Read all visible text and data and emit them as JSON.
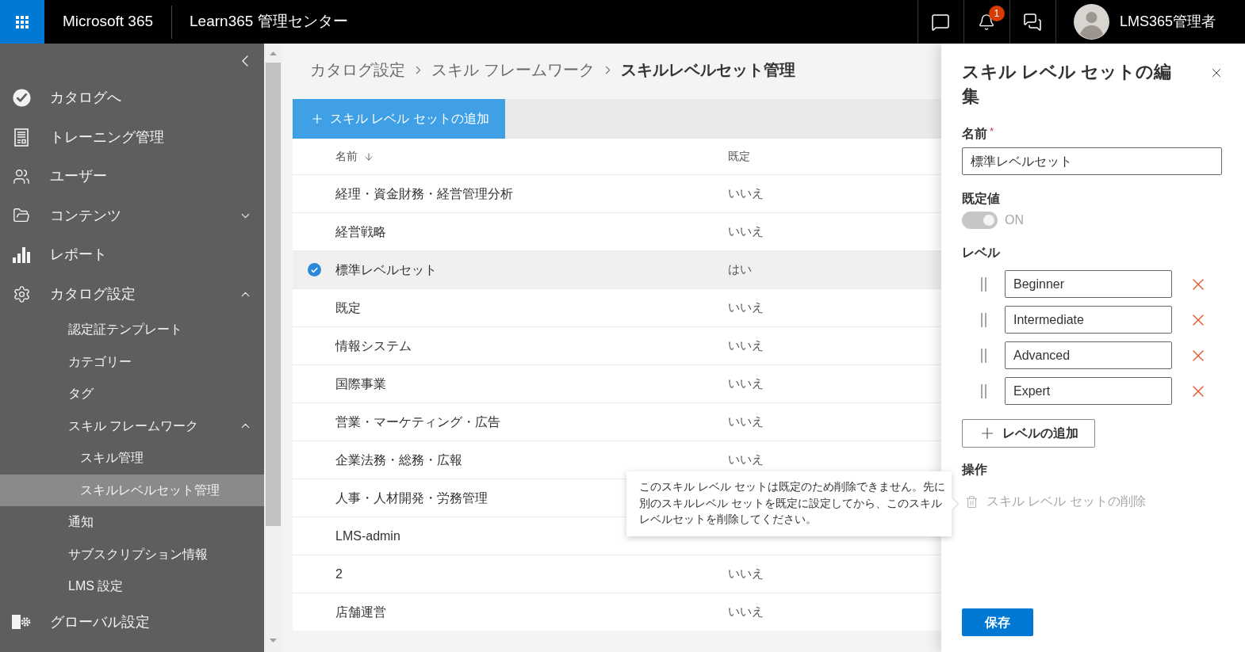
{
  "top_bar": {
    "brand": "Microsoft 365",
    "title": "Learn365 管理センター",
    "notification_badge": "1",
    "user_name": "LMS365管理者"
  },
  "sidebar": {
    "items": [
      {
        "label": "カタログへ",
        "selected": false
      },
      {
        "label": "トレーニング管理",
        "selected": false
      },
      {
        "label": "ユーザー",
        "selected": false
      },
      {
        "label": "コンテンツ",
        "selected": false,
        "expanded": false
      },
      {
        "label": "レポート",
        "selected": false
      },
      {
        "label": "カタログ設定",
        "selected": false,
        "expanded": true,
        "children": [
          {
            "label": "認定証テンプレート",
            "selected": false
          },
          {
            "label": "カテゴリー",
            "selected": false
          },
          {
            "label": "タグ",
            "selected": false
          },
          {
            "label": "スキル フレームワーク",
            "selected": false,
            "expanded": true,
            "children": [
              {
                "label": "スキル管理",
                "selected": false
              },
              {
                "label": "スキルレベルセット管理",
                "selected": true
              }
            ]
          },
          {
            "label": "通知",
            "selected": false
          },
          {
            "label": "サブスクリプション情報",
            "selected": false
          },
          {
            "label": "LMS 設定",
            "selected": false
          }
        ]
      },
      {
        "label": "グローバル設定",
        "selected": false
      }
    ]
  },
  "breadcrumb": [
    "カタログ設定",
    "スキル フレームワーク",
    "スキルレベルセット管理"
  ],
  "toolbar": {
    "add_button": "スキル レベル セットの追加"
  },
  "table": {
    "columns": [
      {
        "label": "名前",
        "sorted": true
      },
      {
        "label": "既定",
        "sorted": false
      }
    ],
    "rows": [
      {
        "name": "経理・資金財務・経営管理分析",
        "default": "いいえ",
        "selected": false
      },
      {
        "name": "経営戦略",
        "default": "いいえ",
        "selected": false
      },
      {
        "name": "標準レベルセット",
        "default": "はい",
        "selected": true
      },
      {
        "name": "既定",
        "default": "いいえ",
        "selected": false
      },
      {
        "name": "情報システム",
        "default": "いいえ",
        "selected": false
      },
      {
        "name": "国際事業",
        "default": "いいえ",
        "selected": false
      },
      {
        "name": "営業・マーケティング・広告",
        "default": "いいえ",
        "selected": false
      },
      {
        "name": "企業法務・総務・広報",
        "default": "いいえ",
        "selected": false
      },
      {
        "name": "人事・人材開発・労務管理",
        "selected": false
      },
      {
        "name": "LMS-admin",
        "selected": false
      },
      {
        "name": "2",
        "default": "いいえ",
        "selected": false
      },
      {
        "name": "店舗運営",
        "default": "いいえ",
        "selected": false
      }
    ]
  },
  "tooltip": {
    "text": "このスキル レベル セットは既定のため削除できません。先に別のスキルレベル セットを既定に設定してから、このスキルレベルセットを削除してください。"
  },
  "panel": {
    "title": "スキル レベル セットの編集",
    "name_field": {
      "label": "名前",
      "required_mark": "*",
      "value": "標準レベルセット"
    },
    "default_field": {
      "label": "既定値",
      "on": true,
      "disabled": true,
      "state_label": "ON"
    },
    "levels": {
      "label": "レベル",
      "items": [
        {
          "value": "Beginner"
        },
        {
          "value": "Intermediate"
        },
        {
          "value": "Advanced"
        },
        {
          "value": "Expert"
        }
      ],
      "add_button": "レベルの追加"
    },
    "actions": {
      "label": "操作",
      "items": [
        {
          "label": "スキル レベル セットの削除",
          "disabled": true
        }
      ]
    },
    "save_button": "保存"
  }
}
